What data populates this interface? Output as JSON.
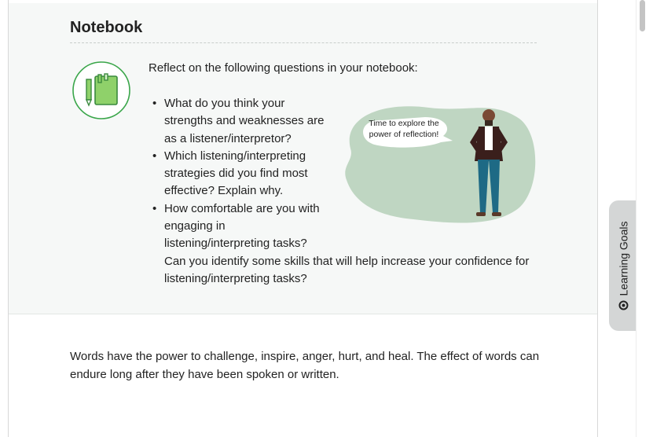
{
  "notebook": {
    "title": "Notebook",
    "intro": "Reflect on the following questions in your notebook:",
    "icon": "notebook-pencil-icon",
    "questions": [
      {
        "text": "What do you think your strengths and weaknesses are as a listener/interpretor?"
      },
      {
        "text": "Which listening/interpreting strategies did you find most effective? Explain why."
      },
      {
        "text": "How comfortable are you with engaging in listening/interpreting tasks?",
        "continuation": "Can you identify some skills that will help increase your confidence for listening/interpreting tasks?"
      }
    ],
    "speech_bubble": "Time to explore the power of reflection!"
  },
  "body": {
    "paragraph": "Words have the power to challenge, inspire, anger, hurt, and heal. The effect of words can endure long after they have been spoken or written."
  },
  "sidebar_tab": {
    "label": "Learning Goals",
    "icon": "target-icon"
  },
  "colors": {
    "panel_bg": "#f6f8f7",
    "icon_green": "#8fd16a",
    "blob_green": "#bfd6c2",
    "tab_bg": "#d4d6d6"
  }
}
